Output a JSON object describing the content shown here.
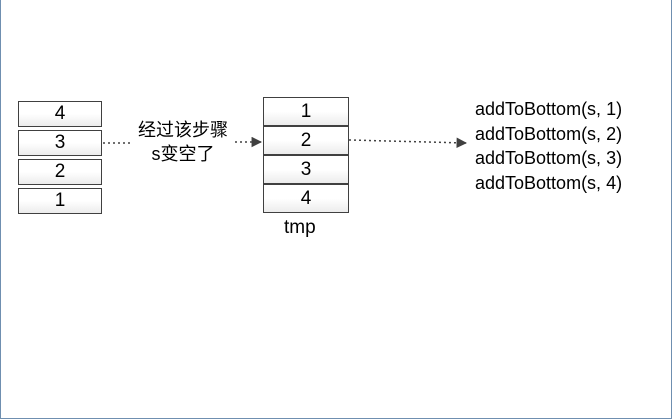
{
  "left_stack": [
    "4",
    "3",
    "2",
    "1"
  ],
  "step_label": [
    "经过该步骤",
    "s变空了"
  ],
  "right_stack": [
    "1",
    "2",
    "3",
    "4"
  ],
  "right_stack_label": "tmp",
  "calls": [
    "addToBottom(s, 1)",
    "addToBottom(s, 2)",
    "addToBottom(s, 3)",
    "addToBottom(s, 4)"
  ]
}
